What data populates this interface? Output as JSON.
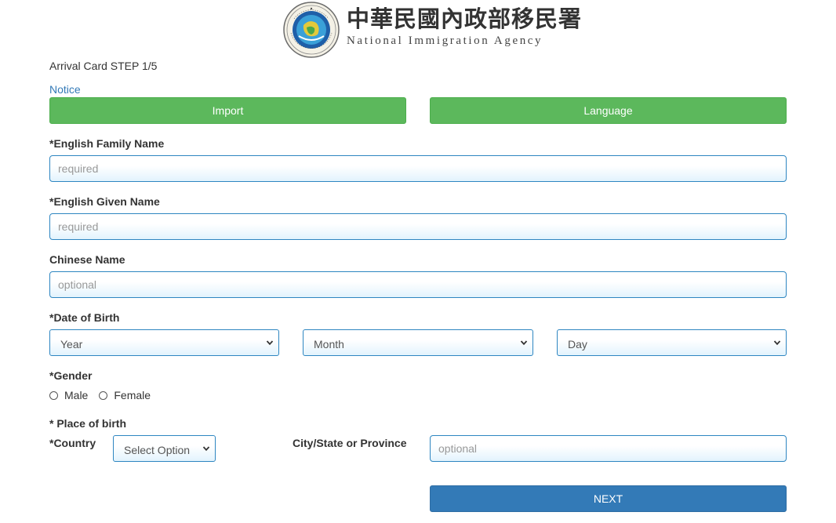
{
  "header": {
    "seal_text": "內政部移民署 National Immigration Agency",
    "title_zh": "中華民國內政部移民署",
    "title_en": "National Immigration Agency"
  },
  "form": {
    "step_title": "Arrival Card STEP 1/5",
    "notice_link": "Notice",
    "import_button": "Import",
    "language_button": "Language",
    "family_name": {
      "label": "*English Family Name",
      "placeholder": "required",
      "value": ""
    },
    "given_name": {
      "label": "*English Given Name",
      "placeholder": "required",
      "value": ""
    },
    "chinese_name": {
      "label": "Chinese Name",
      "placeholder": "optional",
      "value": ""
    },
    "dob": {
      "label": "*Date of Birth",
      "year": "Year",
      "month": "Month",
      "day": "Day"
    },
    "gender": {
      "label": "*Gender",
      "options": [
        "Male",
        "Female"
      ]
    },
    "place_of_birth": {
      "label": "* Place of birth",
      "country_label": "*Country",
      "country_value": "Select Option",
      "city_label": "City/State or Province",
      "city_placeholder": "optional"
    },
    "next_button": "NEXT"
  },
  "colors": {
    "green": "#5cb85c",
    "blue": "#337ab7",
    "input_border": "#2e86c1",
    "link": "#337ab7"
  },
  "icons": {
    "seal": "national-immigration-agency-seal-icon",
    "select_arrow": "chevron-down-icon"
  }
}
